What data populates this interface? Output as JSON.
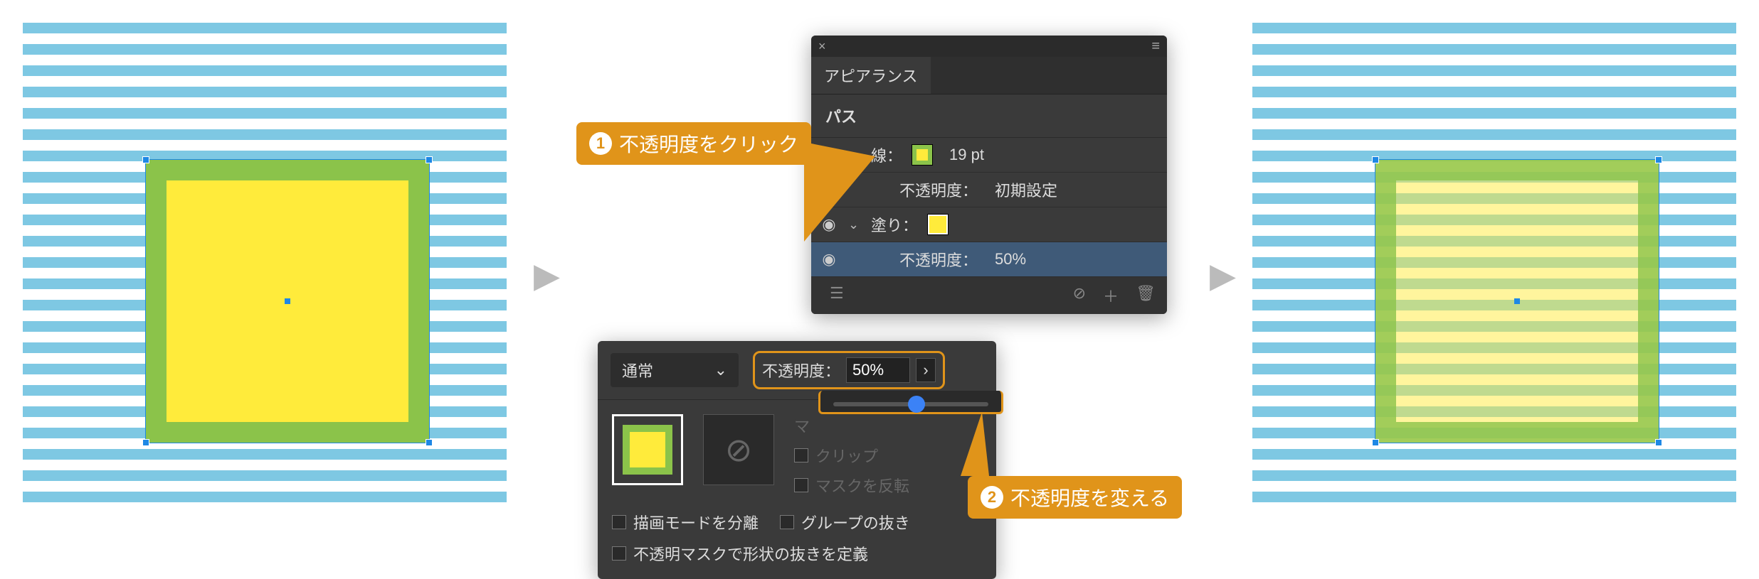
{
  "callouts": {
    "c1_num": "1",
    "c1_text": "不透明度をクリック",
    "c2_num": "2",
    "c2_text": "不透明度を変える"
  },
  "appearance": {
    "tab_label": "アピアランス",
    "section": "パス",
    "stroke_label": "線：",
    "stroke_value": "19 pt",
    "stroke_opacity_label": "不透明度：",
    "stroke_opacity_value": "初期設定",
    "fill_label": "塗り：",
    "fill_opacity_label": "不透明度：",
    "fill_opacity_value": "50%"
  },
  "transparency": {
    "blend_mode": "通常",
    "opacity_label": "不透明度：",
    "opacity_value": "50%",
    "mask_btn": "マ",
    "clip_label": "クリップ",
    "invert_label": "マスクを反転",
    "isolate_label": "描画モードを分離",
    "knockout_label": "グループの抜き",
    "define_label": "不透明マスクで形状の抜きを定義"
  },
  "chart_data": {
    "type": "table",
    "title": "Attribute opacity change (Adobe Illustrator Appearance panel)",
    "rows": [
      {
        "attribute": "線 (stroke)",
        "value": "19 pt",
        "opacity": "初期設定"
      },
      {
        "attribute": "塗り (fill)",
        "value": "yellow",
        "opacity": "50%"
      }
    ]
  }
}
